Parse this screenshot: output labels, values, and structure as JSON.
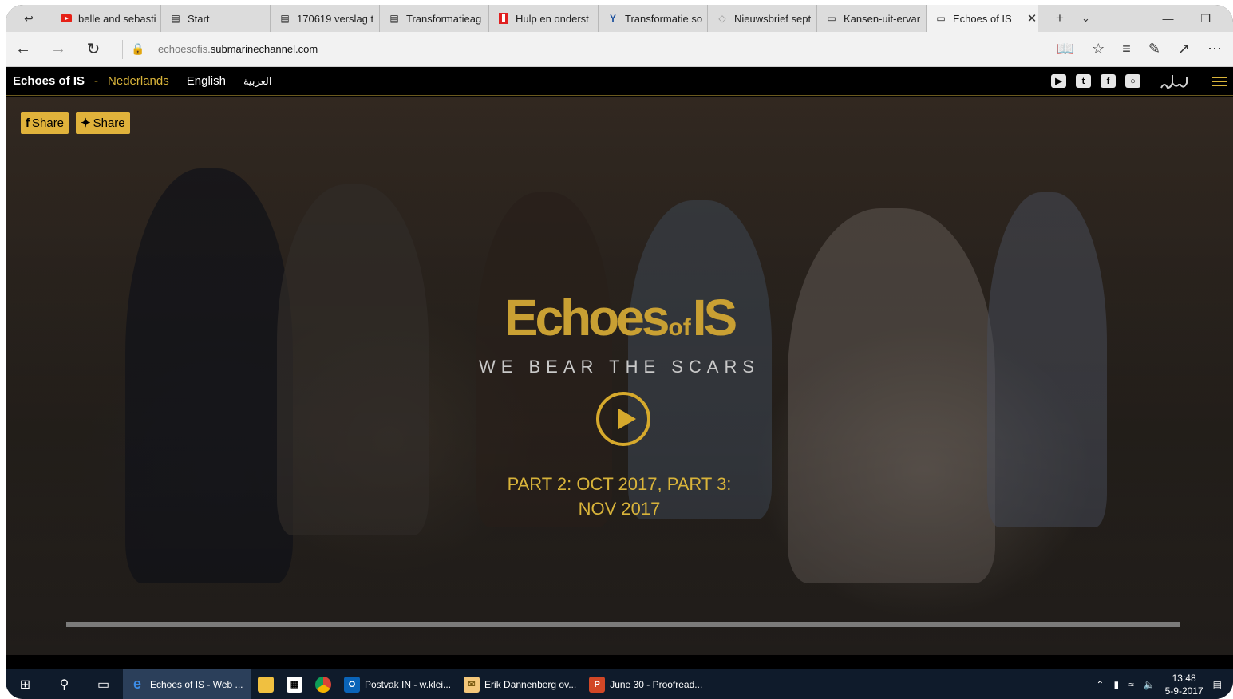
{
  "browser": {
    "tabs": [
      {
        "label": "belle and sebasti",
        "icon": "youtube-icon"
      },
      {
        "label": "Start",
        "icon": "page-icon"
      },
      {
        "label": "170619 verslag t",
        "icon": "document-icon"
      },
      {
        "label": "Transformatieag",
        "icon": "document-icon"
      },
      {
        "label": "Hulp en onderst",
        "icon": "red-flag-icon"
      },
      {
        "label": "Transformatie so",
        "icon": "logo-icon"
      },
      {
        "label": "Nieuwsbrief sept",
        "icon": "diamond-icon"
      },
      {
        "label": "Kansen-uit-ervar",
        "icon": "window-icon"
      },
      {
        "label": "Echoes of IS",
        "icon": "window-icon",
        "active": true
      }
    ],
    "url_host_prefix": "echoesofis.",
    "url_host_main": "submarinechannel.com"
  },
  "site": {
    "brand": "Echoes of IS",
    "dash": "-",
    "languages": [
      "Nederlands",
      "English",
      "العربية"
    ],
    "active_language": "Nederlands",
    "social": [
      "youtube-icon",
      "twitter-icon",
      "facebook-icon",
      "instagram-icon"
    ],
    "share_facebook_label": "Share",
    "share_twitter_label": "Share",
    "logo_main": "Echoes",
    "logo_of": "of",
    "logo_is": "IS",
    "tagline": "WE BEAR THE SCARS",
    "parts_line1": "PART 2: OCT 2017, PART 3:",
    "parts_line2": "NOV 2017",
    "accent_color": "#d9b43a"
  },
  "taskbar": {
    "apps": [
      {
        "label": "Echoes of IS - Web ...",
        "icon": "edge-icon",
        "active": true
      },
      {
        "label": "",
        "icon": "file-explorer-icon"
      },
      {
        "label": "",
        "icon": "store-icon"
      },
      {
        "label": "",
        "icon": "chrome-icon"
      },
      {
        "label": "Postvak IN - w.klei...",
        "icon": "outlook-icon"
      },
      {
        "label": "Erik Dannenberg ov...",
        "icon": "mail-icon"
      },
      {
        "label": "June 30 - Proofread...",
        "icon": "powerpoint-icon"
      }
    ],
    "time": "13:48",
    "date": "5-9-2017"
  }
}
